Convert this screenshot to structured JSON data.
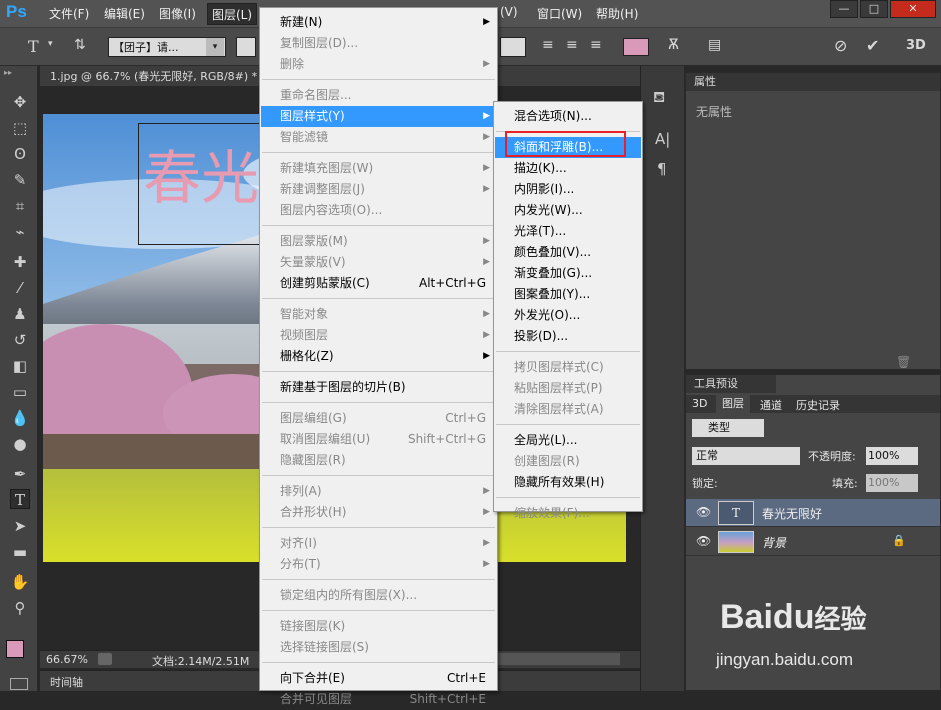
{
  "app": {
    "logo": "Ps"
  },
  "menubar": {
    "items": [
      "文件(F)",
      "编辑(E)",
      "图像(I)",
      "图层(L)"
    ],
    "right_items": [
      "(V)",
      "窗口(W)",
      "帮助(H)"
    ],
    "win_controls": [
      "—",
      "□",
      "✕"
    ]
  },
  "options_bar": {
    "tool_letter": "T",
    "font_preset": "【团子】请...",
    "size_label": "",
    "color_swatch": "#d89ab8",
    "threed_label": "3D"
  },
  "document": {
    "tab_title": "1.jpg @ 66.7% (春光无限好, RGB/8#) *",
    "text_layer_text": "春光",
    "text_color": "#e79ab0"
  },
  "status": {
    "zoom": "66.67%",
    "doc_size": "文档:2.14M/2.51M"
  },
  "timeline": {
    "label": "时间轴"
  },
  "properties_panel": {
    "tab": "属性",
    "empty_text": "无属性"
  },
  "tool_presets": {
    "tab": "工具预设"
  },
  "layers_panel": {
    "tabs": [
      "3D",
      "图层",
      "通道",
      "历史记录"
    ],
    "filter": "类型",
    "blend_mode": "正常",
    "opacity_label": "不透明度:",
    "opacity_value": "100%",
    "lock_label": "锁定:",
    "fill_label": "填充:",
    "fill_value": "100%",
    "layers": [
      {
        "name": "春光无限好",
        "type": "T"
      },
      {
        "name": "背景",
        "type": "image"
      }
    ]
  },
  "layer_menu": {
    "items": [
      {
        "label": "新建(N)",
        "arrow": true,
        "disabled": false
      },
      {
        "label": "复制图层(D)...",
        "disabled": true
      },
      {
        "label": "删除",
        "arrow": true,
        "disabled": true
      },
      {
        "label": "重命名图层...",
        "disabled": true
      },
      {
        "label": "图层样式(Y)",
        "arrow": true,
        "highlight": true
      },
      {
        "label": "智能滤镜",
        "arrow": true,
        "disabled": true
      },
      {
        "label": "新建填充图层(W)",
        "arrow": true,
        "disabled": true
      },
      {
        "label": "新建调整图层(J)",
        "arrow": true,
        "disabled": true
      },
      {
        "label": "图层内容选项(O)...",
        "disabled": true
      },
      {
        "label": "图层蒙版(M)",
        "arrow": true,
        "disabled": true
      },
      {
        "label": "矢量蒙版(V)",
        "arrow": true,
        "disabled": true
      },
      {
        "label": "创建剪贴蒙版(C)",
        "shortcut": "Alt+Ctrl+G"
      },
      {
        "label": "智能对象",
        "arrow": true,
        "disabled": true
      },
      {
        "label": "视频图层",
        "arrow": true,
        "disabled": true
      },
      {
        "label": "栅格化(Z)",
        "arrow": true
      },
      {
        "label": "新建基于图层的切片(B)"
      },
      {
        "label": "图层编组(G)",
        "shortcut": "Ctrl+G",
        "disabled": true
      },
      {
        "label": "取消图层编组(U)",
        "shortcut": "Shift+Ctrl+G",
        "disabled": true
      },
      {
        "label": "隐藏图层(R)",
        "disabled": true
      },
      {
        "label": "排列(A)",
        "arrow": true,
        "disabled": true
      },
      {
        "label": "合并形状(H)",
        "arrow": true,
        "disabled": true
      },
      {
        "label": "对齐(I)",
        "arrow": true,
        "disabled": true
      },
      {
        "label": "分布(T)",
        "arrow": true,
        "disabled": true
      },
      {
        "label": "锁定组内的所有图层(X)...",
        "disabled": true
      },
      {
        "label": "链接图层(K)",
        "disabled": true
      },
      {
        "label": "选择链接图层(S)",
        "disabled": true
      },
      {
        "label": "向下合并(E)",
        "shortcut": "Ctrl+E"
      },
      {
        "label": "合并可见图层",
        "shortcut": "Shift+Ctrl+E",
        "disabled": true
      }
    ]
  },
  "style_submenu": {
    "items": [
      {
        "label": "混合选项(N)..."
      },
      {
        "label": "斜面和浮雕(B)...",
        "highlight": true
      },
      {
        "label": "描边(K)..."
      },
      {
        "label": "内阴影(I)..."
      },
      {
        "label": "内发光(W)..."
      },
      {
        "label": "光泽(T)..."
      },
      {
        "label": "颜色叠加(V)..."
      },
      {
        "label": "渐变叠加(G)..."
      },
      {
        "label": "图案叠加(Y)..."
      },
      {
        "label": "外发光(O)..."
      },
      {
        "label": "投影(D)..."
      },
      {
        "label": "拷贝图层样式(C)",
        "disabled": true
      },
      {
        "label": "粘贴图层样式(P)",
        "disabled": true
      },
      {
        "label": "清除图层样式(A)",
        "disabled": true
      },
      {
        "label": "全局光(L)..."
      },
      {
        "label": "创建图层(R)",
        "disabled": true
      },
      {
        "label": "隐藏所有效果(H)"
      },
      {
        "label": "缩放效果(F)...",
        "disabled": true
      }
    ]
  },
  "watermark": {
    "brand": "Bai",
    "brand2": "du",
    "brand3": "经验",
    "url": "jingyan.baidu.com"
  }
}
